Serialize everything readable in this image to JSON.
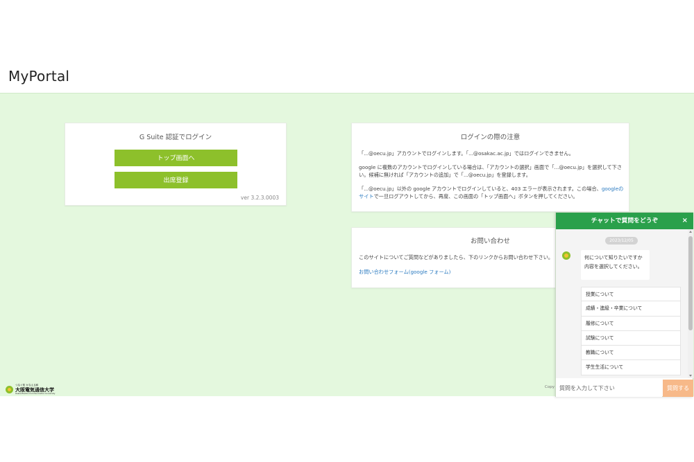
{
  "header": {
    "brand": "MyPortal"
  },
  "login": {
    "title": "G Suite 認証でログイン",
    "top_button": "トップ画面へ",
    "attendance_button": "出席登録",
    "version": "ver 3.2.3.0003"
  },
  "notice": {
    "title": "ログインの際の注意",
    "p1": "「...@oecu.jp」アカウントでログインします。「...@osakac.ac.jp」ではログインできません。",
    "p2": "google に複数のアカウントでログインしている場合は、「アカウントの選択」画面で「...@oecu.jp」を選択して下さい。候補に無ければ「アカウントの追加」で「...@oecu.jp」を登録します。",
    "p3_before": "「...@oecu.jp」以外の google アカウントでログインしていると、403 エラーが表示されます。この場合、",
    "p3_link": "googleのサイト",
    "p3_after": "で一旦ログアウトしてから、再度、この画面の「トップ画面へ」ボタンを押してください。"
  },
  "inquiry": {
    "title": "お問い合わせ",
    "text": "このサイトについてご質問などがありましたら、下のリンクからお問い合わせ下さい。",
    "link": "お問い合わせフォーム(google フォーム)"
  },
  "footer": {
    "logo_small": "つなぐ知 かなえる和",
    "logo_main": "大阪電気通信大学",
    "logo_sub": "Osaka Electro-Communication University",
    "copy": "Copy"
  },
  "chat": {
    "title": "チャットで質問をどうぞ",
    "close": "×",
    "date": "2023/12/05",
    "bot_line1": "何について知りたいですか",
    "bot_line2": "内容を選択してください。",
    "options": [
      "授業について",
      "成績・進級・卒業について",
      "履修について",
      "試験について",
      "教職について",
      "学生生活について"
    ],
    "input_placeholder": "質問を入力して下さい",
    "send": "質問する"
  },
  "colors": {
    "accent_green": "#8dc02b",
    "chat_header": "#2aa04b",
    "background": "#e4f8de",
    "send_button": "#f7b989",
    "link": "#2a7ac0"
  }
}
